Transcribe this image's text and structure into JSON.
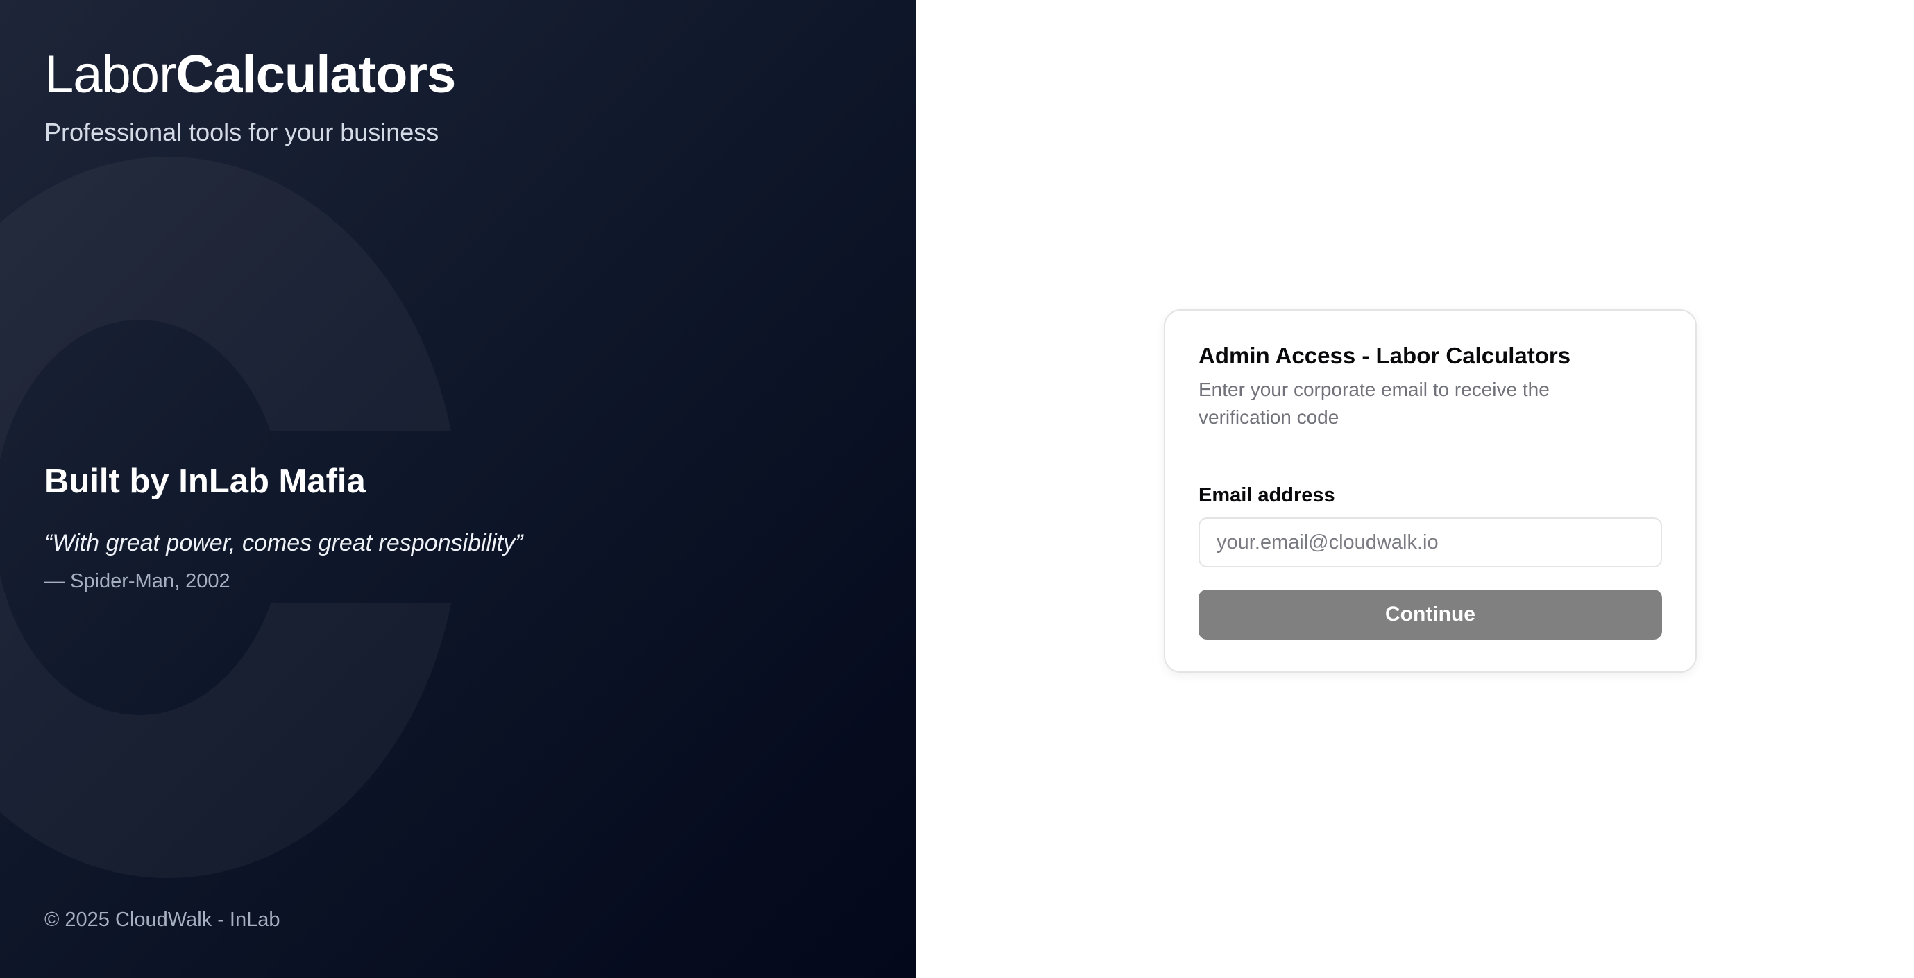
{
  "brand": {
    "name_light": "Labor",
    "name_bold": "Calculators",
    "tagline": "Professional tools for your business",
    "background_letter": "C"
  },
  "hero": {
    "built_by": "Built by InLab Mafia",
    "quote": "“With great power, comes great responsibility”",
    "attribution": "— Spider-Man, 2002"
  },
  "footer": {
    "copyright": "© 2025 CloudWalk - InLab"
  },
  "login_card": {
    "title": "Admin Access - Labor Calculators",
    "description": "Enter your corporate email to receive the verification code",
    "email_label": "Email address",
    "email_placeholder": "your.email@cloudwalk.io",
    "email_value": "",
    "continue_label": "Continue"
  },
  "colors": {
    "left_panel_start": "#1e2538",
    "left_panel_end": "#03081a",
    "button_disabled": "#808080",
    "card_border": "#e4e4e7"
  }
}
